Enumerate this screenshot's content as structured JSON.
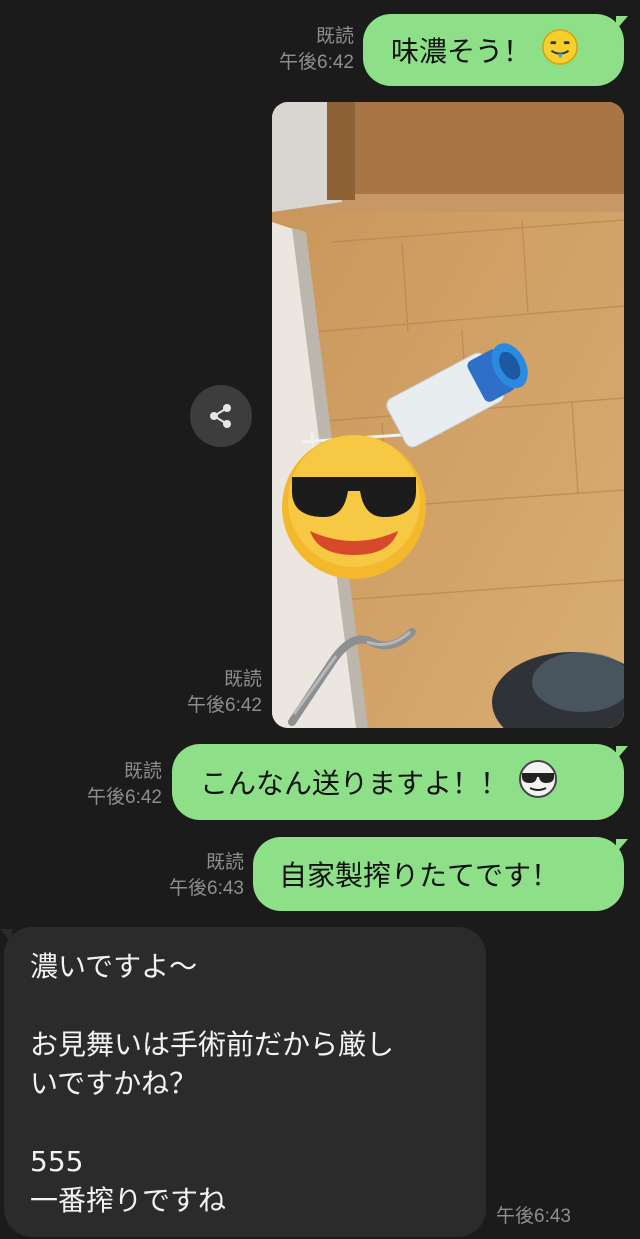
{
  "messages": [
    {
      "direction": "outgoing",
      "read_label": "既読",
      "time": "午後6:42",
      "text": "味濃そう！",
      "emoji": "drooling-face-emoji"
    },
    {
      "direction": "outgoing",
      "type": "image",
      "read_label": "既読",
      "time": "午後6:42",
      "image_description_icon": "sunglasses-face-emoji"
    },
    {
      "direction": "outgoing",
      "read_label": "既読",
      "time": "午後6:42",
      "text": "こんなん送りますよ！！",
      "emoji": "sunglasses-face-emoji"
    },
    {
      "direction": "outgoing",
      "read_label": "既読",
      "time": "午後6:43",
      "text": "自家製搾りたてです！"
    },
    {
      "direction": "incoming",
      "time": "午後6:43",
      "text": "濃いですよ〜\n\nお見舞いは手術前だから厳し\nいですかね？\n\n555\n一番搾りですね"
    }
  ],
  "share_button_icon": "share-icon",
  "colors": {
    "background": "#1b1b1b",
    "outgoing_bubble": "#8de087",
    "incoming_bubble": "#2b2b2b",
    "meta_text": "#8e8e8e",
    "share_button": "#3d3d3d"
  }
}
